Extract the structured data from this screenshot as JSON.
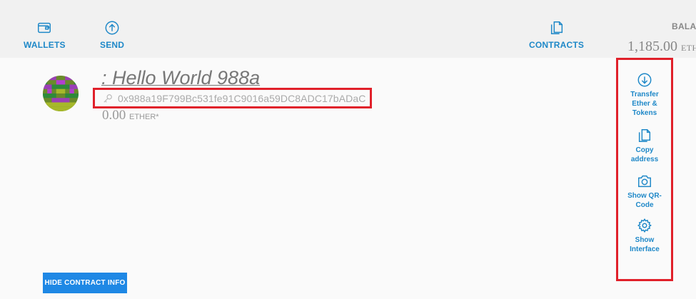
{
  "nav": {
    "wallets_label": "WALLETS",
    "send_label": "SEND",
    "contracts_label": "CONTRACTS"
  },
  "balance": {
    "label": "BALANC",
    "value": "1,185.00",
    "unit": "ETHER"
  },
  "account": {
    "title": ": Hello World 988a",
    "address": "0x988a19F799Bc531fe91C9016a59DC8ADC17bADaC",
    "balance_value": "0.00",
    "balance_unit": "ETHER*"
  },
  "actions": [
    {
      "label": "Transfer Ether & Tokens",
      "icon": "download-circle-icon"
    },
    {
      "label": "Copy address",
      "icon": "copy-icon"
    },
    {
      "label": "Show QR-Code",
      "icon": "camera-icon"
    },
    {
      "label": "Show Interface",
      "icon": "gear-icon"
    }
  ],
  "hide_contract_info_label": "HIDE CONTRACT INFO",
  "colors": {
    "accent": "#1e88c8",
    "button": "#1e88e5",
    "highlight": "#e0202a"
  }
}
